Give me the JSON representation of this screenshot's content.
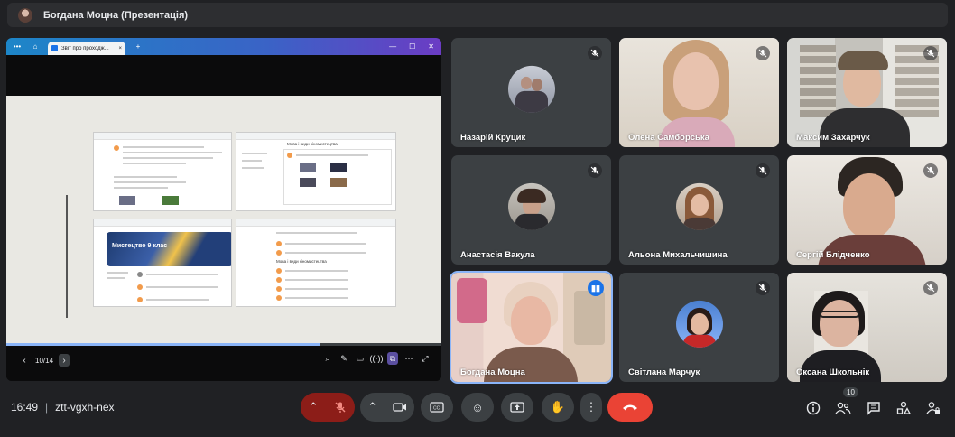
{
  "window": {
    "title": "Богдана Моцна (Презентація)"
  },
  "presentation": {
    "browser_tab_title": "Звіт про проходж...",
    "page_counter": "10/14",
    "progress_fraction": 0.72,
    "thumb2_heading": "Мова і види кіномистецтва",
    "thumb3_banner": "Мистецтво 9 клас",
    "thumb4_heading": "Мова і види кіномистецтва"
  },
  "participants": [
    {
      "name": "Назарій Круцик",
      "muted": true
    },
    {
      "name": "Олена Самборська",
      "muted": true
    },
    {
      "name": "Максим Захарчук",
      "muted": true
    },
    {
      "name": "Анастасія Вакула",
      "muted": true
    },
    {
      "name": "Альона Михальчишина",
      "muted": true
    },
    {
      "name": "Сергій Блідченко",
      "muted": true
    },
    {
      "name": "Богдана Моцна",
      "speaking": true
    },
    {
      "name": "Світлана Марчук",
      "muted": true
    },
    {
      "name": "Оксана Школьнік",
      "muted": true
    }
  ],
  "controls": {
    "time": "16:49",
    "meeting_code": "ztt-vgxh-nex",
    "participant_count": "10"
  },
  "colors": {
    "accent": "#8ab4f8",
    "end_call": "#ea4335",
    "mic_off": "#8c1d18",
    "tile_bg": "#3c4043"
  }
}
